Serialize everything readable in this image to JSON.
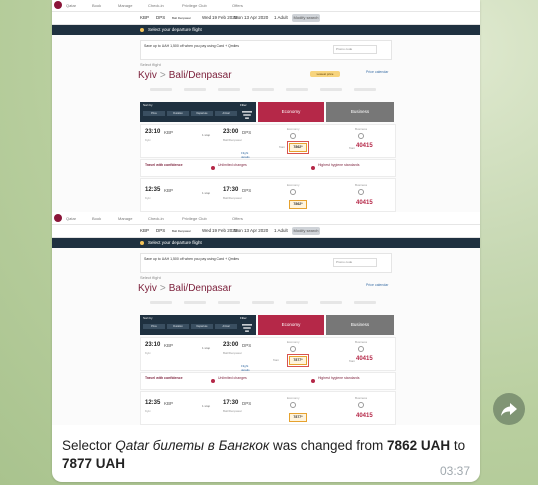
{
  "message": {
    "prefix": "Selector ",
    "selector_name": "Qatar билеты в Бангкок",
    "middle": " was changed from ",
    "old_value": "7862 UAH",
    "to_word": " to",
    "new_value": "7877 UAH",
    "time": "03:37"
  },
  "screenshot": {
    "search_bar": {
      "origin": "KBP",
      "destination": "DPS",
      "destination_sub": "Bali Denpasar",
      "depart_label": "Wed",
      "depart_date": "19 Feb 2020",
      "return_label": "Mon",
      "return_date": "13 Apr 2020",
      "pax": "1 Adult",
      "search_button": "Modify search"
    },
    "banner": "Select your departure flight",
    "save_text": "Save up to UAH 1,500 off when you pay using Card + Qmiles",
    "save_input": "Promo code",
    "select_days": "Select flight",
    "route_from": "Kyiv",
    "route_to": "Bali/Denpasar",
    "route_chevron": ">",
    "badge": "Lowest price",
    "price_link": "Price calendar",
    "sort_label": "Sort by",
    "sort_buttons": [
      "Price",
      "Duration",
      "Departure",
      "Arrival"
    ],
    "filter_label": "Filter",
    "economy_header": "Economy",
    "business_header": "Business",
    "flights": [
      {
        "dep_time": "23:10",
        "dep_iata": "KBP",
        "dep_sub": "Kyiv",
        "arr_time": "23:00",
        "arr_iata": "DPS",
        "arr_sub": "Bali/Denpasar",
        "duration": "1 stop",
        "details": "Flight details",
        "eco_label": "Economy",
        "eco_price": "7862*",
        "eco_old": "from",
        "bus_label": "Business",
        "bus_from": "from",
        "bus_price": "40415"
      },
      {
        "dep_time": "12:35",
        "dep_iata": "KBP",
        "dep_sub": "Kyiv",
        "arr_time": "17:30",
        "arr_iata": "DPS",
        "arr_sub": "Bali/Denpasar",
        "duration": "1 stop",
        "details": "Flight details",
        "eco_label": "Economy",
        "eco_price": "7862*",
        "eco_old": "from",
        "bus_label": "Business",
        "bus_from": "from",
        "bus_price": "40415"
      }
    ],
    "flights2": [
      {
        "eco_price": "7877*",
        "bus_price": "40415"
      },
      {
        "eco_price": "7877*",
        "bus_price": "40415"
      }
    ],
    "confidence": {
      "title": "Travel with confidence",
      "flex_title": "Unlimited changes",
      "hygiene_title": "Highest hygiene standards"
    },
    "tabs": [
      "Qatar",
      "Book",
      "Manage",
      "Check-in",
      "Privilege Club",
      "Offers"
    ]
  },
  "colors": {
    "qatar_maroon": "#8a1538",
    "economy_header": "#b52848",
    "navy": "#1f3140"
  },
  "icons": [
    "share-icon",
    "qatar-logo-icon",
    "filter-icon"
  ]
}
